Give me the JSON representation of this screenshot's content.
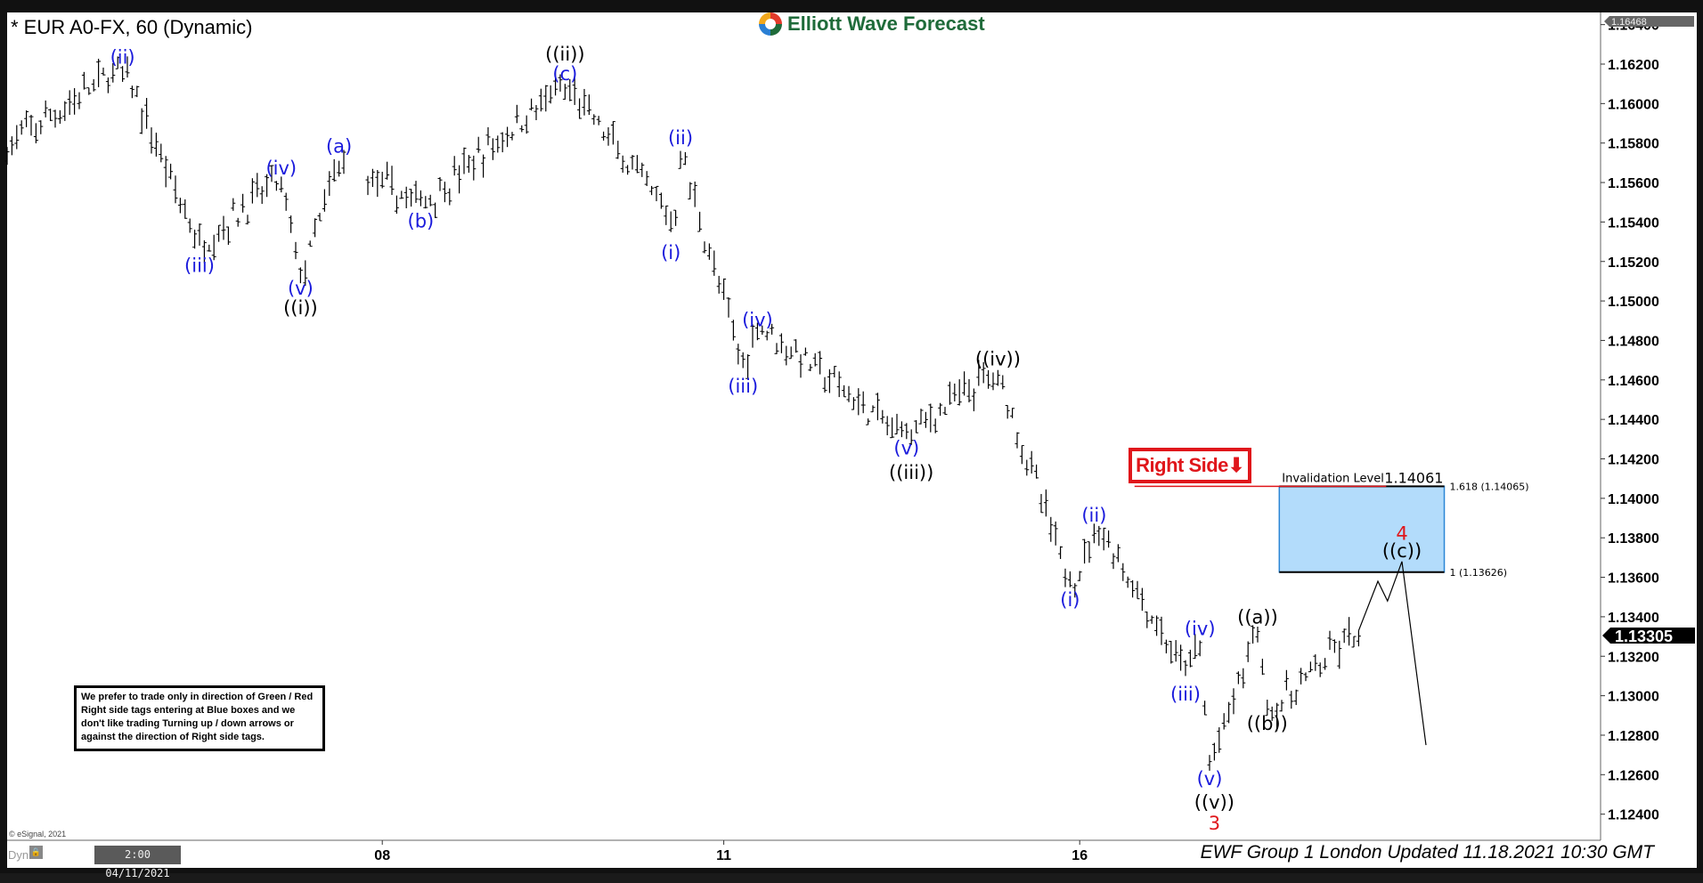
{
  "header": {
    "title": "* EUR A0-FX, 60 (Dynamic)",
    "logo_text": "Elliott Wave Forecast"
  },
  "disclaimer": "We prefer to trade only in direction of Green / Red Right side tags entering at Blue boxes and we don't like trading Turning up / down arrows or against the direction of Right side tags.",
  "right_side_tag": {
    "label": "Right Side",
    "arrow": "⬇",
    "color": "#e0161b"
  },
  "footer": {
    "copyright": "© eSignal, 2021",
    "dyn": "Dyn",
    "dyn_icon": "lock-icon",
    "start_datetime": "2:00 04/11/2021",
    "updated": "EWF Group 1 London Updated 11.18.2021 10:30 GMT"
  },
  "chart_data": {
    "type": "ohlc-bar",
    "x_unit": "hourly bar index",
    "ylim": [
      1.1232,
      1.1652
    ],
    "y_ticks": [
      "1.16400",
      "1.16200",
      "1.16000",
      "1.15800",
      "1.15600",
      "1.15400",
      "1.15200",
      "1.15000",
      "1.14800",
      "1.14600",
      "1.14400",
      "1.14200",
      "1.14000",
      "1.13800",
      "1.13600",
      "1.13400",
      "1.13200",
      "1.13000",
      "1.12800",
      "1.12600",
      "1.12400"
    ],
    "x_ticks": [
      {
        "bar": 78,
        "label": "08"
      },
      {
        "bar": 149,
        "label": "11"
      },
      {
        "bar": 223,
        "label": "16"
      }
    ],
    "price_tags": {
      "top": "1.16468",
      "last": "1.13305"
    },
    "pivots": [
      [
        0,
        1.1578
      ],
      [
        24,
        1.1619
      ],
      [
        40,
        1.1528
      ],
      [
        57,
        1.1563
      ],
      [
        61,
        1.1509
      ],
      [
        69,
        1.1571
      ],
      [
        86,
        1.1548
      ],
      [
        116,
        1.161
      ],
      [
        139,
        1.1538
      ],
      [
        140,
        1.1576
      ],
      [
        153,
        1.1466
      ],
      [
        156,
        1.1489
      ],
      [
        186,
        1.1431
      ],
      [
        206,
        1.1465
      ],
      [
        221,
        1.1355
      ],
      [
        227,
        1.1386
      ],
      [
        245,
        1.131
      ],
      [
        248,
        1.1328
      ],
      [
        250,
        1.1262
      ],
      [
        260,
        1.1335
      ],
      [
        262,
        1.129
      ],
      [
        281,
        1.1333
      ]
    ],
    "projection": [
      [
        281,
        1.1333
      ],
      [
        285,
        1.1358
      ],
      [
        287,
        1.1348
      ],
      [
        290,
        1.1368
      ],
      [
        295,
        1.1275
      ]
    ],
    "blue_box": {
      "from_bar": 264.5,
      "to_bar": 298.8,
      "top": 1.14061,
      "bottom": 1.13626,
      "color": "#b3dcfb"
    },
    "invalidation": {
      "from_bar": 234.4,
      "price": 1.14061,
      "label": "Invalidation Level",
      "value": "1.14061",
      "color": "#e0161b"
    },
    "fib_labels": [
      {
        "price": 1.14061,
        "text": "1.618 (1.14065)"
      },
      {
        "price": 1.13626,
        "text": "1 (1.13626)"
      }
    ],
    "wave_labels": [
      {
        "t": "(ii)",
        "bar": 24,
        "p": 1.16233,
        "c": "#1a1adc"
      },
      {
        "t": "(iii)",
        "bar": 40,
        "p": 1.15178,
        "c": "#1a1adc"
      },
      {
        "t": "(iv)",
        "bar": 57,
        "p": 1.15673,
        "c": "#1a1adc"
      },
      {
        "t": "(v)",
        "bar": 61,
        "p": 1.15063,
        "c": "#1a1adc"
      },
      {
        "t": "((i))",
        "bar": 61,
        "p": 1.14964,
        "c": "#000000"
      },
      {
        "t": "(a)",
        "bar": 69,
        "p": 1.15782,
        "c": "#1a1adc"
      },
      {
        "t": "(b)",
        "bar": 86,
        "p": 1.15403,
        "c": "#1a1adc"
      },
      {
        "t": "((ii))",
        "bar": 116,
        "p": 1.16249,
        "c": "#000000"
      },
      {
        "t": "(c)",
        "bar": 116,
        "p": 1.16151,
        "c": "#1a1adc"
      },
      {
        "t": "(ii)",
        "bar": 140,
        "p": 1.15826,
        "c": "#1a1adc"
      },
      {
        "t": "(i)",
        "bar": 138,
        "p": 1.15244,
        "c": "#1a1adc"
      },
      {
        "t": "(iv)",
        "bar": 156,
        "p": 1.14903,
        "c": "#1a1adc"
      },
      {
        "t": "(iii)",
        "bar": 153,
        "p": 1.14568,
        "c": "#1a1adc"
      },
      {
        "t": "(v)",
        "bar": 187,
        "p": 1.14255,
        "c": "#1a1adc"
      },
      {
        "t": "((iii))",
        "bar": 188,
        "p": 1.14129,
        "c": "#000000"
      },
      {
        "t": "((iv))",
        "bar": 206,
        "p": 1.14706,
        "c": "#000000"
      },
      {
        "t": "(ii)",
        "bar": 226,
        "p": 1.13914,
        "c": "#1a1adc"
      },
      {
        "t": "(i)",
        "bar": 221,
        "p": 1.13486,
        "c": "#1a1adc"
      },
      {
        "t": "(iv)",
        "bar": 248,
        "p": 1.13338,
        "c": "#1a1adc"
      },
      {
        "t": "(iii)",
        "bar": 245,
        "p": 1.13008,
        "c": "#1a1adc"
      },
      {
        "t": "((a))",
        "bar": 260,
        "p": 1.13398,
        "c": "#000000"
      },
      {
        "t": "((b))",
        "bar": 262,
        "p": 1.12859,
        "c": "#000000"
      },
      {
        "t": "(v)",
        "bar": 250,
        "p": 1.12579,
        "c": "#1a1adc"
      },
      {
        "t": "((v))",
        "bar": 251,
        "p": 1.12459,
        "c": "#000000"
      },
      {
        "t": "3",
        "bar": 251,
        "p": 1.12354,
        "c": "#e0161b"
      },
      {
        "t": "4",
        "bar": 290,
        "p": 1.13821,
        "c": "#e0161b"
      },
      {
        "t": "((c))",
        "bar": 290,
        "p": 1.13733,
        "c": "#000000"
      }
    ]
  }
}
